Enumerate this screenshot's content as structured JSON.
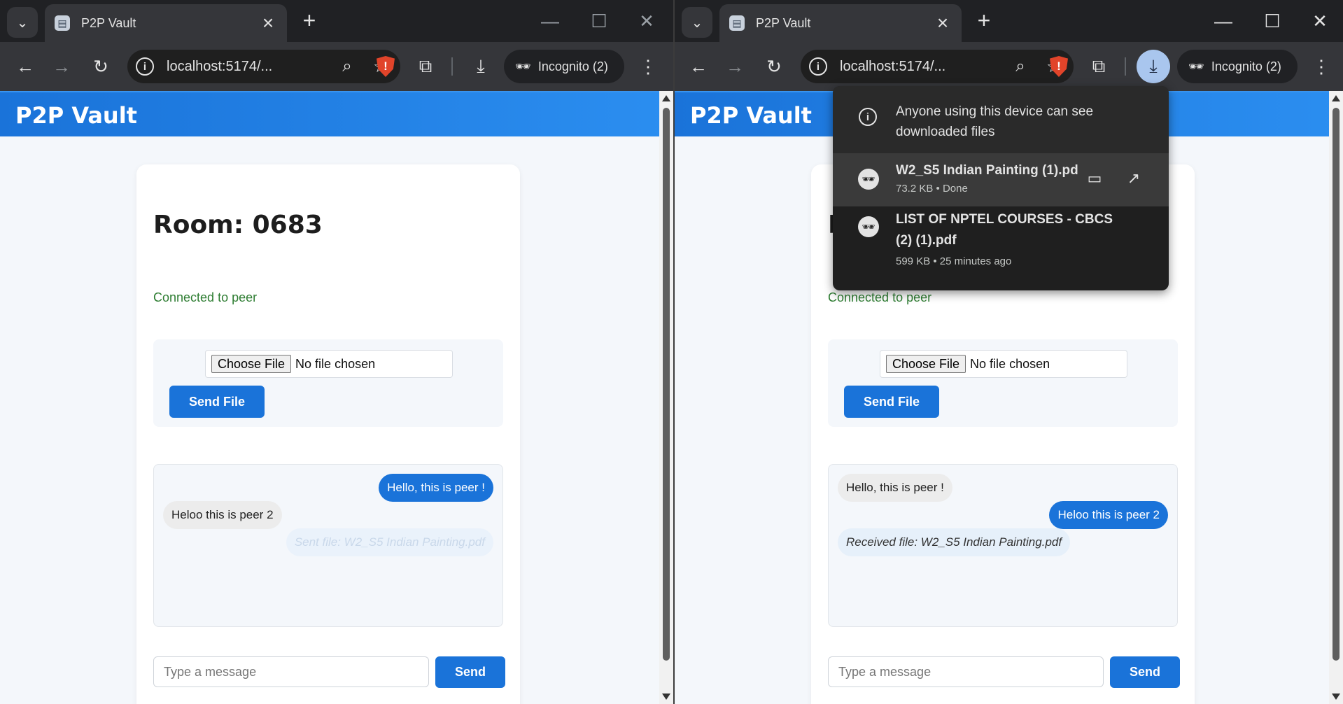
{
  "tab": {
    "title": "P2P Vault"
  },
  "omnibox": {
    "url": "localhost:5174/..."
  },
  "incognito": {
    "label": "Incognito (2)"
  },
  "app": {
    "title": "P2P Vault",
    "room": "Room: 0683",
    "status": "Connected to peer",
    "choose_file": "Choose File",
    "no_file": "No file chosen",
    "send_file": "Send File",
    "message_placeholder": "Type a message",
    "send": "Send"
  },
  "left_messages": [
    {
      "text": "Hello, this is peer !",
      "kind": "me"
    },
    {
      "text": "Heloo this is peer 2",
      "kind": "peer"
    },
    {
      "text": "Sent file: W2_S5 Indian Painting.pdf",
      "kind": "file"
    }
  ],
  "right_messages": [
    {
      "text": "Hello, this is peer !",
      "kind": "peer"
    },
    {
      "text": "Heloo this is peer 2",
      "kind": "me"
    },
    {
      "text": "Received file: W2_S5 Indian Painting.pdf",
      "kind": "file"
    }
  ],
  "downloads": {
    "notice": "Anyone using this device can see downloaded files",
    "items": [
      {
        "name": "W2_S5 Indian Painting (1).pd",
        "meta": "73.2 KB • Done"
      },
      {
        "name": "LIST OF NPTEL COURSES - CBCS (2) (1).pdf",
        "meta": "599 KB • 25 minutes ago"
      }
    ]
  },
  "colors": {
    "accent": "#1a73d9",
    "connected": "#2e7d32",
    "chrome_dark": "#202124"
  }
}
